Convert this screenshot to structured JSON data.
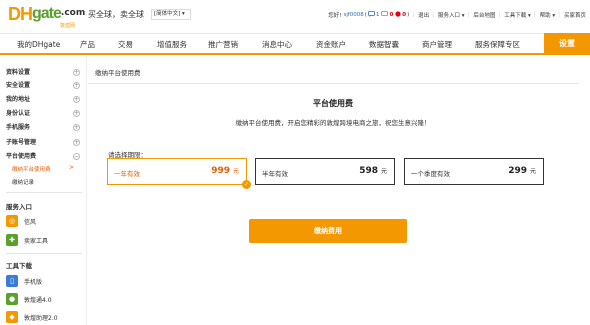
{
  "header": {
    "logo_dh": "DH",
    "logo_gate": "gate",
    "logo_com": ".com",
    "logo_sub": "敦煌网",
    "slogan": "买全球，卖全球",
    "lang": "[简体中文] ▾",
    "greeting": "您好!",
    "username": "sjf0008",
    "msg_open": "(",
    "msg_count1": "1",
    "msg_count2": "0",
    "msg_count3": "0",
    "msg_close": ")",
    "logout": "退出",
    "service_entry": "服务入口 ▾",
    "backend_map": "后台地图",
    "tools_download": "工具下载 ▾",
    "help": "帮助 ▾",
    "seller_home": "买家首页"
  },
  "mainnav": {
    "items": [
      "我的DHgate",
      "产品",
      "交易",
      "增值服务",
      "推广营销",
      "消息中心",
      "资金账户",
      "数据智囊",
      "商户管理",
      "服务保障专区"
    ],
    "active": "设置"
  },
  "sidebar": {
    "groups": [
      "资料设置",
      "安全设置",
      "我的地址",
      "身份认证",
      "手机服务",
      "子账号管理",
      "平台使用费"
    ],
    "sub_active": "缴纳平台使用费",
    "sub_active_arrow": ">",
    "sub_record": "缴纳记录",
    "service_title": "服务入口",
    "service_items": [
      "信风",
      "卖家工具"
    ],
    "tools_title": "工具下载",
    "tool_items": [
      "手机版",
      "敦煌通4.0",
      "敦煌助理2.0"
    ],
    "plus": "+"
  },
  "content": {
    "breadcrumb": "缴纳平台使用费",
    "title": "平台使用费",
    "desc": "缴纳平台使用费，开启您精彩的敦煌跨境电商之旅，祝您生意兴隆！",
    "period_label": "请选择期限：",
    "options": [
      {
        "name": "一年有效",
        "price": "999",
        "unit": "元"
      },
      {
        "name": "半年有效",
        "price": "598",
        "unit": "元"
      },
      {
        "name": "一个季度有效",
        "price": "299",
        "unit": "元"
      }
    ],
    "selected_index": 0,
    "check_mark": "✓",
    "pay_button": "缴纳费用"
  },
  "colors": {
    "accent": "#f39800",
    "accent_text": "#e85d00",
    "logo_green": "#5aa02c"
  }
}
